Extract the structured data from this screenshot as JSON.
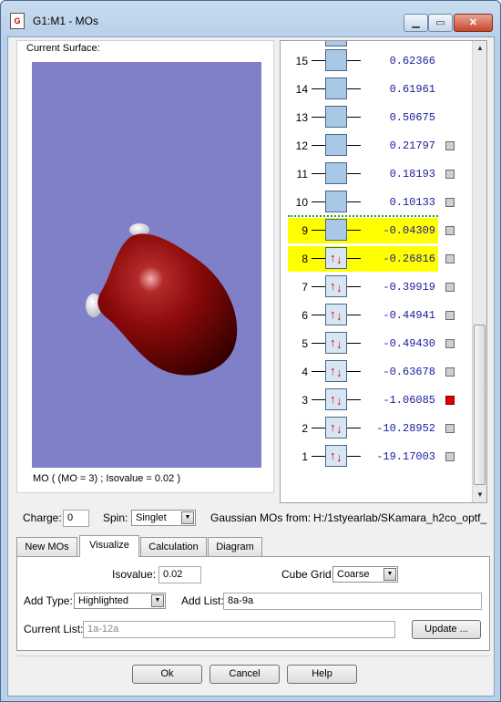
{
  "window": {
    "title": "G1:M1 - MOs",
    "app_icon": "gaussview-icon",
    "controls": {
      "minimize": "minimize-icon",
      "maximize": "maximize-icon",
      "close": "close-icon"
    }
  },
  "surface": {
    "label": "Current Surface:",
    "caption": "MO ( (MO = 3) ; Isovalue = 0.02 )",
    "background_color": "#7f80c8",
    "lobe_color": "#8b0a0a"
  },
  "orbitals": [
    {
      "num": "15",
      "energy": "0.62366",
      "occupied": false,
      "highlighted": false,
      "checkbox": false
    },
    {
      "num": "14",
      "energy": "0.61961",
      "occupied": false,
      "highlighted": false,
      "checkbox": false
    },
    {
      "num": "13",
      "energy": "0.50675",
      "occupied": false,
      "highlighted": false,
      "checkbox": false
    },
    {
      "num": "12",
      "energy": "0.21797",
      "occupied": false,
      "highlighted": false,
      "checkbox": true
    },
    {
      "num": "11",
      "energy": "0.18193",
      "occupied": false,
      "highlighted": false,
      "checkbox": true
    },
    {
      "num": "10",
      "energy": "0.10133",
      "occupied": false,
      "highlighted": false,
      "checkbox": true
    },
    {
      "num": "9",
      "energy": "-0.04309",
      "occupied": false,
      "highlighted": true,
      "checkbox": true
    },
    {
      "num": "8",
      "energy": "-0.26816",
      "occupied": true,
      "highlighted": true,
      "checkbox": true
    },
    {
      "num": "7",
      "energy": "-0.39919",
      "occupied": true,
      "highlighted": false,
      "checkbox": true
    },
    {
      "num": "6",
      "energy": "-0.44941",
      "occupied": true,
      "highlighted": false,
      "checkbox": true
    },
    {
      "num": "5",
      "energy": "-0.49430",
      "occupied": true,
      "highlighted": false,
      "checkbox": true
    },
    {
      "num": "4",
      "energy": "-0.63678",
      "occupied": true,
      "highlighted": false,
      "checkbox": true
    },
    {
      "num": "3",
      "energy": "-1.06085",
      "occupied": true,
      "highlighted": false,
      "checkbox": true,
      "selected": true
    },
    {
      "num": "2",
      "energy": "-10.28952",
      "occupied": true,
      "highlighted": false,
      "checkbox": true
    },
    {
      "num": "1",
      "energy": "-19.17003",
      "occupied": true,
      "highlighted": false,
      "checkbox": true
    }
  ],
  "colors": {
    "highlight": "#ffff00",
    "selected_checkbox": "#e00000",
    "energy_text": "#1a1aa0",
    "electron_arrow": "#d00000"
  },
  "charge": {
    "label": "Charge:",
    "value": "0"
  },
  "spin": {
    "label": "Spin:",
    "value": "Singlet"
  },
  "source": {
    "label": "Gaussian MOs from:",
    "path": "H:/1styearlab/SKamara_h2co_optf_"
  },
  "tabs": [
    "New MOs",
    "Visualize",
    "Calculation",
    "Diagram"
  ],
  "active_tab": "Visualize",
  "visualize": {
    "isovalue_label": "Isovalue:",
    "isovalue": "0.02",
    "cube_grid_label": "Cube Grid:",
    "cube_grid": "Coarse",
    "add_type_label": "Add Type:",
    "add_type": "Highlighted",
    "add_list_label": "Add List:",
    "add_list": "8a-9a",
    "current_list_label": "Current List:",
    "current_list": "1a-12a",
    "update_button": "Update ..."
  },
  "buttons": {
    "ok": "Ok",
    "cancel": "Cancel",
    "help": "Help"
  }
}
